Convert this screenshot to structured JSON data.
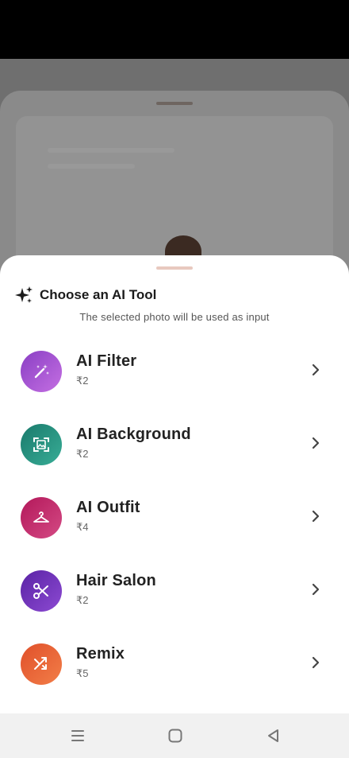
{
  "sheet": {
    "title": "Choose an AI Tool",
    "subtitle": "The selected photo will be used as input",
    "icon": "sparkles-icon"
  },
  "tools": [
    {
      "name": "AI Filter",
      "price": "₹2",
      "icon": "magic-wand-icon",
      "color_start": "#8a3fc4",
      "color_end": "#c26be0"
    },
    {
      "name": "AI Background",
      "price": "₹2",
      "icon": "image-frame-icon",
      "color_start": "#1c7e70",
      "color_end": "#34a892"
    },
    {
      "name": "AI Outfit",
      "price": "₹4",
      "icon": "hanger-icon",
      "color_start": "#b5195a",
      "color_end": "#d24680"
    },
    {
      "name": "Hair Salon",
      "price": "₹2",
      "icon": "scissors-icon",
      "color_start": "#5d25a8",
      "color_end": "#8a46d0"
    },
    {
      "name": "Remix",
      "price": "₹5",
      "icon": "shuffle-icon",
      "color_start": "#e2542a",
      "color_end": "#f07a45"
    }
  ],
  "nav": [
    "menu-icon",
    "home-icon",
    "back-icon"
  ]
}
